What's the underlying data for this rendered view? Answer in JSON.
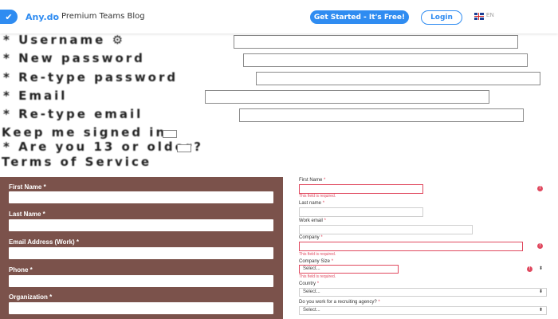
{
  "header": {
    "brand": "Any.do",
    "chevron": "⌄",
    "blog_link": "Premium Teams Blog",
    "get_started": "Get Started - It's Free!",
    "login": "Login",
    "lang_icon": "uk-flag-icon",
    "lang_label": "EN"
  },
  "old_form": {
    "username": "* Username ⚙",
    "new_password": "* New password",
    "retype_password": "* Re-type password",
    "email": "* Email",
    "retype_email": "* Re-type email",
    "keep_signed": "Keep me signed in",
    "age_check": "* Are you 13 or older?",
    "terms": "Terms of Service"
  },
  "brown_form": {
    "first_name": "First Name *",
    "last_name": "Last Name *",
    "email_work": "Email Address (Work) *",
    "phone": "Phone *",
    "organization": "Organization *"
  },
  "right_form": {
    "first_name": "First Name",
    "last_name": "Last name",
    "work_email": "Work email",
    "company": "Company",
    "company_size": "Company Size",
    "country": "Country",
    "recruiting": "Do you work for a recruiting agency?",
    "required_mark": "*",
    "error_msg": "This field is required.",
    "select_placeholder": "Select..."
  },
  "colors": {
    "accent": "#2f8cf1",
    "brown_panel": "#7b524b",
    "error": "#e0495f"
  }
}
